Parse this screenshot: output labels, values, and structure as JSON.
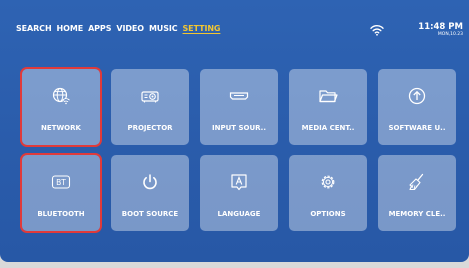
{
  "nav": {
    "items": [
      {
        "label": "SEARCH"
      },
      {
        "label": "HOME"
      },
      {
        "label": "APPS"
      },
      {
        "label": "VIDEO"
      },
      {
        "label": "MUSIC"
      },
      {
        "label": "SETTING",
        "active": true
      }
    ]
  },
  "status": {
    "wifi_icon": "wifi-icon",
    "time": "11:48 PM",
    "date": "MON,10.23"
  },
  "tiles": [
    {
      "label": "NETWORK",
      "icon": "globe-wifi-icon",
      "selected": true
    },
    {
      "label": "PROJECTOR",
      "icon": "projector-icon"
    },
    {
      "label": "INPUT SOUR..",
      "icon": "hdmi-icon"
    },
    {
      "label": "MEDIA CENT..",
      "icon": "folder-icon"
    },
    {
      "label": "SOFTWARE U..",
      "icon": "upload-icon"
    },
    {
      "label": "BLUETOOTH",
      "icon": "bt-icon",
      "selected": true
    },
    {
      "label": "BOOT SOURCE",
      "icon": "power-icon"
    },
    {
      "label": "LANGUAGE",
      "icon": "language-icon"
    },
    {
      "label": "OPTIONS",
      "icon": "gear-icon"
    },
    {
      "label": "MEMORY CLE..",
      "icon": "broom-icon"
    }
  ],
  "colors": {
    "background": "#2e63b3",
    "active_nav": "#f2c631",
    "selection": "#e03a3a"
  }
}
